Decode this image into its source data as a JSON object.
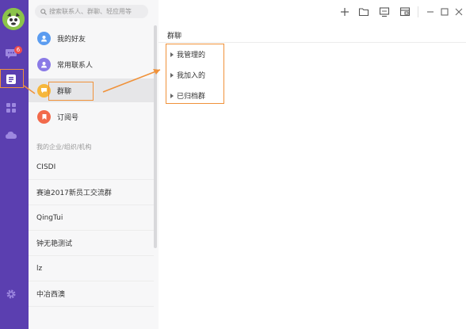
{
  "search": {
    "placeholder": "搜索联系人、群聊、轻应用等"
  },
  "rail": {
    "unread_badge": "6"
  },
  "contacts": {
    "items": [
      {
        "label": "我的好友",
        "color": "#5b9cf0"
      },
      {
        "label": "常用联系人",
        "color": "#8a7ae6"
      },
      {
        "label": "群聊",
        "color": "#f6b73c"
      },
      {
        "label": "订阅号",
        "color": "#f26a4b"
      }
    ],
    "section_title": "我的企业/组织/机构",
    "orgs": [
      "CISDI",
      "赛迪2017新员工交流群",
      "QingTui",
      "钟无艳测试",
      "lz",
      "中冶西澳"
    ]
  },
  "main": {
    "title": "群聊",
    "groups": [
      "我管理的",
      "我加入的",
      "已归档群"
    ]
  },
  "colors": {
    "rail": "#5b3fb0",
    "highlight": "#f0923a"
  }
}
